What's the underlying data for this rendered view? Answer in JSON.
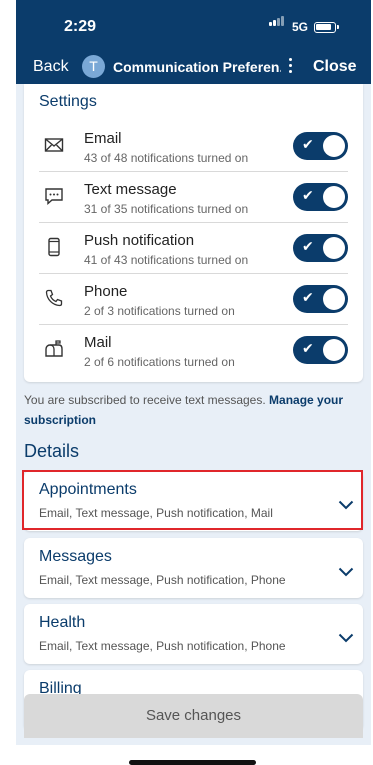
{
  "status": {
    "time": "2:29",
    "network": "5G"
  },
  "nav": {
    "back_label": "Back",
    "avatar_letter": "T",
    "title": "Communication Preferen...",
    "close_label": "Close"
  },
  "settings": {
    "title": "Settings",
    "items": [
      {
        "label": "Email",
        "sub": "43 of 48 notifications turned on",
        "icon": "envelope-icon",
        "enabled": true
      },
      {
        "label": "Text message",
        "sub": "31 of 35 notifications turned on",
        "icon": "chat-bubble-icon",
        "enabled": true
      },
      {
        "label": "Push notification",
        "sub": "41 of 43 notifications turned on",
        "icon": "phone-icon",
        "enabled": true
      },
      {
        "label": "Phone",
        "sub": "2 of 3 notifications turned on",
        "icon": "handset-icon",
        "enabled": true
      },
      {
        "label": "Mail",
        "sub": "2 of 6 notifications turned on",
        "icon": "mailbox-icon",
        "enabled": true
      }
    ]
  },
  "subscription": {
    "note": "You are subscribed to receive text messages.",
    "link": "Manage your subscription"
  },
  "details": {
    "title": "Details",
    "items": [
      {
        "title": "Appointments",
        "sub": "Email, Text message, Push notification, Mail"
      },
      {
        "title": "Messages",
        "sub": "Email, Text message, Push notification, Phone"
      },
      {
        "title": "Health",
        "sub": "Email, Text message, Push notification, Phone"
      },
      {
        "title": "Billing",
        "sub": ""
      }
    ]
  },
  "footer": {
    "save_label": "Save changes"
  },
  "colors": {
    "brand": "#0b3c6b",
    "background": "#e8eff7",
    "highlight": "#e0262b"
  }
}
